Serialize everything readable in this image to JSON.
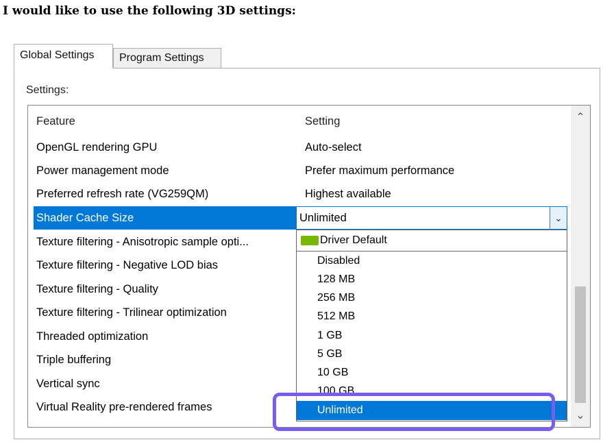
{
  "heading": "I would like to use the following 3D settings:",
  "tabs": [
    {
      "label": "Global Settings",
      "active": true
    },
    {
      "label": "Program Settings",
      "active": false
    }
  ],
  "settings_label": "Settings:",
  "table": {
    "columns": [
      "Feature",
      "Setting"
    ],
    "rows": [
      {
        "feature": "OpenGL rendering GPU",
        "setting": "Auto-select"
      },
      {
        "feature": "Power management mode",
        "setting": "Prefer maximum performance"
      },
      {
        "feature": "Preferred refresh rate (VG259QM)",
        "setting": "Highest available"
      },
      {
        "feature": "Shader Cache Size",
        "setting": "Unlimited",
        "selected": true
      },
      {
        "feature": "Texture filtering - Anisotropic sample opti...",
        "setting": ""
      },
      {
        "feature": "Texture filtering - Negative LOD bias",
        "setting": ""
      },
      {
        "feature": "Texture filtering - Quality",
        "setting": ""
      },
      {
        "feature": "Texture filtering - Trilinear optimization",
        "setting": ""
      },
      {
        "feature": "Threaded optimization",
        "setting": ""
      },
      {
        "feature": "Triple buffering",
        "setting": ""
      },
      {
        "feature": "Vertical sync",
        "setting": ""
      },
      {
        "feature": "Virtual Reality pre-rendered frames",
        "setting": ""
      }
    ]
  },
  "dropdown": {
    "current": "Unlimited",
    "default_option": "Driver Default",
    "options": [
      "Disabled",
      "128 MB",
      "256 MB",
      "512 MB",
      "1 GB",
      "5 GB",
      "10 GB",
      "100 GB",
      "Unlimited"
    ],
    "highlighted": "Unlimited"
  },
  "icons": {
    "combo_arrow": "chevron-down-icon",
    "scroll_up": "chevron-up-icon",
    "scroll_down": "chevron-down-icon",
    "driver_default": "nvidia-logo-icon"
  },
  "colors": {
    "selection": "#0078d7",
    "annotation": "#7b5cf0",
    "nvidia_green": "#76b900"
  }
}
